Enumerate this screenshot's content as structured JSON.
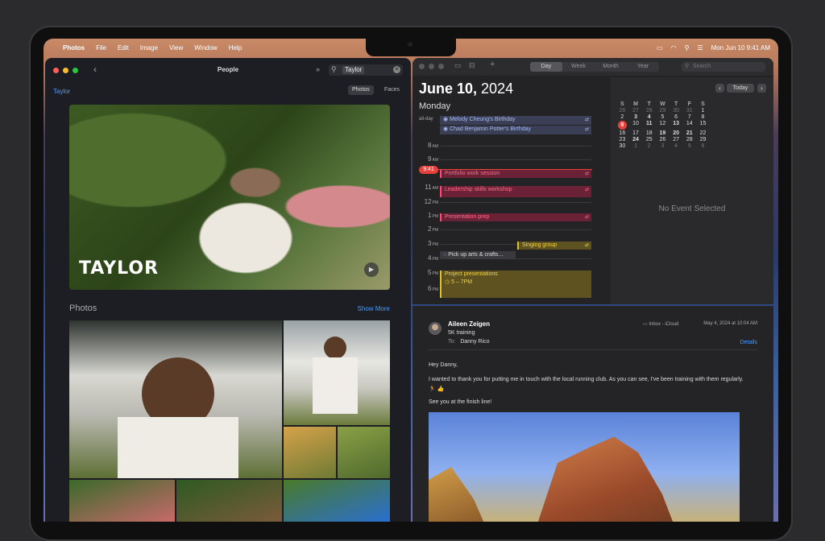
{
  "menubar": {
    "apple": "",
    "app": "Photos",
    "items": [
      "File",
      "Edit",
      "Image",
      "View",
      "Window",
      "Help"
    ],
    "clock": "Mon Jun 10  9:41 AM"
  },
  "photos": {
    "title": "People",
    "search_token": "Taylor",
    "breadcrumb": "Taylor",
    "seg_photos": "Photos",
    "seg_faces": "Faces",
    "hero_name": "TAYLOR",
    "section_title": "Photos",
    "show_more": "Show More"
  },
  "calendar": {
    "views": [
      "Day",
      "Week",
      "Month",
      "Year"
    ],
    "search_placeholder": "Search",
    "date_bold": "June 10,",
    "year": " 2024",
    "weekday": "Monday",
    "allday_label": "all-day",
    "allday_events": [
      "Melody Cheung's Birthday",
      "Chad Benjamin Potter's Birthday"
    ],
    "hours": [
      {
        "n": "8",
        "ap": "AM"
      },
      {
        "n": "9",
        "ap": "AM"
      },
      {
        "n": "10",
        "ap": "AM"
      },
      {
        "n": "11",
        "ap": "AM"
      },
      {
        "n": "12",
        "ap": "PM"
      },
      {
        "n": "1",
        "ap": "PM"
      },
      {
        "n": "2",
        "ap": "PM"
      },
      {
        "n": "3",
        "ap": "PM"
      },
      {
        "n": "4",
        "ap": "PM"
      },
      {
        "n": "5",
        "ap": "PM"
      },
      {
        "n": "6",
        "ap": "PM"
      }
    ],
    "now": "9:41",
    "events": [
      "Portfolio work session",
      "Leadership skills workshop",
      "Presentation prep",
      "Singing group",
      "Pick up arts & crafts...",
      "Project presentations"
    ],
    "event_time": "5 – 7PM",
    "today_button": "Today",
    "mini_headers": [
      "S",
      "M",
      "T",
      "W",
      "T",
      "F",
      "S"
    ],
    "mini_days": [
      "26",
      "27",
      "28",
      "29",
      "30",
      "31",
      "1",
      "2",
      "3",
      "4",
      "5",
      "6",
      "7",
      "8",
      "9",
      "10",
      "11",
      "12",
      "13",
      "14",
      "15",
      "16",
      "17",
      "18",
      "19",
      "20",
      "21",
      "22",
      "23",
      "24",
      "25",
      "26",
      "27",
      "28",
      "29",
      "30",
      "1",
      "2",
      "3",
      "4",
      "5",
      "6"
    ],
    "no_event": "No Event Selected",
    "colors": {
      "red": "#e8403a",
      "pink": "#c23a5a",
      "yellow": "#d9b832",
      "purple": "#a25cd6",
      "blue": "#6a8be0"
    }
  },
  "mail": {
    "from": "Aileen Zeigen",
    "subject": "5K training",
    "to_label": "To:",
    "to_name": "Danny Rico",
    "mailbox": "Inbox - iCloud",
    "date": "May 4, 2024 at 10:04 AM",
    "details": "Details",
    "greeting": "Hey Danny,",
    "body1": "I wanted to thank you for putting me in touch with the local running club. As you can see, I've been training with them regularly.",
    "body2": "🏃 👍",
    "body3": "See you at the finish line!"
  }
}
